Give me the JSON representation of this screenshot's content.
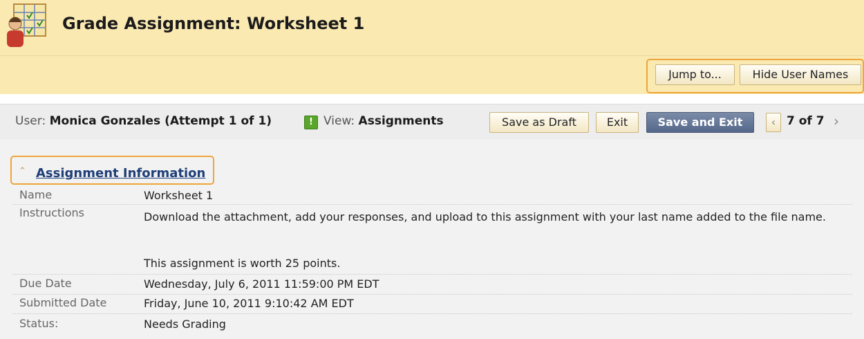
{
  "header": {
    "title": "Grade Assignment: Worksheet 1"
  },
  "action_bar": {
    "jump_to_label": "Jump to...",
    "hide_names_label": "Hide User Names"
  },
  "user_bar": {
    "user_label": "User:",
    "user_value": "Monica Gonzales (Attempt 1 of 1)",
    "view_label": "View:",
    "view_value": "Assignments",
    "save_draft_label": "Save as Draft",
    "exit_label": "Exit",
    "save_exit_label": "Save and Exit",
    "pager_text": "7 of 7",
    "status_icon": "needs-grading-icon"
  },
  "section": {
    "title": "Assignment Information",
    "rows": [
      {
        "key": "Name",
        "value": "Worksheet 1"
      },
      {
        "key": "Instructions",
        "value": "Download the attachment, add your responses, and upload to this assignment with your last name added to the file name.",
        "extra": "This assignment is worth 25 points."
      },
      {
        "key": "Due Date",
        "value": "Wednesday, July 6, 2011 11:59:00 PM EDT"
      },
      {
        "key": "Submitted Date",
        "value": "Friday, June 10, 2011 9:10:42 AM EDT"
      },
      {
        "key": "Status:",
        "value": "Needs Grading"
      }
    ]
  },
  "colors": {
    "header_bg": "#fbe9b2",
    "highlight": "#eea53a",
    "link": "#1f3f78",
    "primary_button": "#55678a",
    "status_green": "#5aa62a"
  }
}
